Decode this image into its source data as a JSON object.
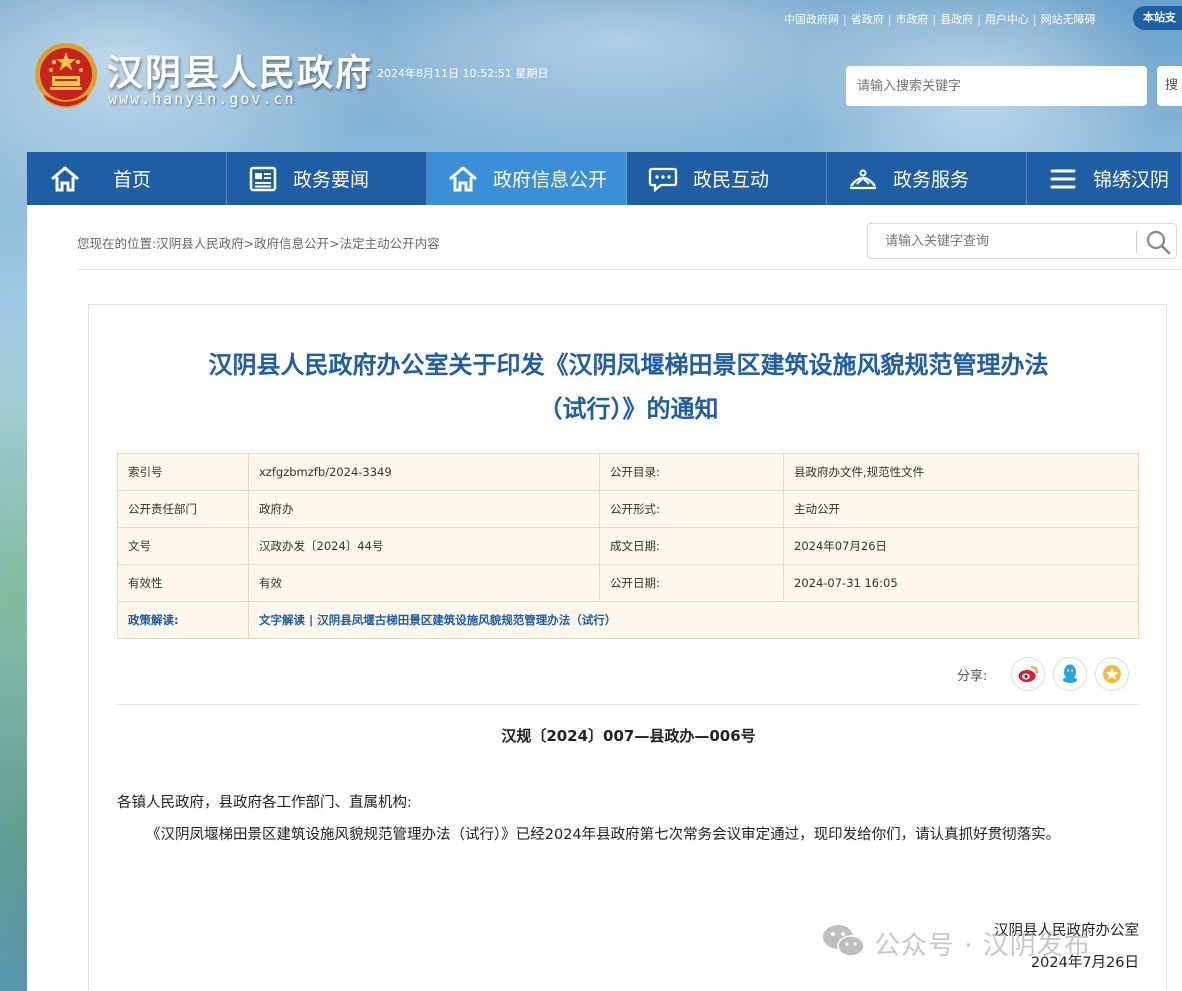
{
  "header": {
    "top_links": [
      "中国政府网",
      "省政府",
      "市政府",
      "县政府",
      "用户中心",
      "网站无障碍"
    ],
    "support_label": "本站支",
    "site_title": "汉阴县人民政府",
    "site_domain": "www.hanyin.gov.cn",
    "datetime": "2024年8月11日 10:52:51 星期日",
    "search_placeholder": "请输入搜索关键字",
    "search_button": "搜"
  },
  "nav": {
    "items": [
      {
        "label": "首页",
        "icon": "home-icon"
      },
      {
        "label": "政务要闻",
        "icon": "news-icon"
      },
      {
        "label": "政府信息公开",
        "icon": "home-icon"
      },
      {
        "label": "政民互动",
        "icon": "chat-icon"
      },
      {
        "label": "政务服务",
        "icon": "service-icon"
      },
      {
        "label": "锦绣汉阴",
        "icon": "menu-icon"
      }
    ],
    "active_index": 2
  },
  "breadcrumb": "您现在的位置:汉阴县人民政府>政府信息公开>法定主动公开内容",
  "inner_search": {
    "placeholder": "请输入关键字查询"
  },
  "article": {
    "title_line1": "汉阴县人民政府办公室关于印发《汉阴凤堰梯田景区建筑设施风貌规范管理办法",
    "title_line2": "（试行）》的通知",
    "meta": {
      "index_label": "索引号",
      "index_value": "xzfgzbmzfb/2024-3349",
      "catalog_label": "公开目录:",
      "catalog_value": "县政府办文件,规范性文件",
      "dept_label": "公开责任部门",
      "dept_value": "政府办",
      "form_label": "公开形式:",
      "form_value": "主动公开",
      "docnum_label": "文号",
      "docnum_value": "汉政办发〔2024〕44号",
      "created_label": "成文日期:",
      "created_value": "2024年07月26日",
      "validity_label": "有效性",
      "validity_value": "有效",
      "published_label": "公开日期:",
      "published_value": "2024-07-31 16:05",
      "policy_label": "政策解读:",
      "policy_value": "文字解读 | 汉阴县凤堰古梯田景区建筑设施风貌规范管理办法（试行）"
    },
    "share_label": "分享:",
    "share_icons": [
      "weibo-icon",
      "qq-icon",
      "favorite-icon"
    ],
    "doc_number": "汉规〔2024〕007—县政办—006号",
    "salutation": "各镇人民政府，县政府各工作部门、直属机构:",
    "body": "《汉阴凤堰梯田景区建筑设施风貌规范管理办法（试行）》已经2024年县政府第七次常务会议审定通过，现印发给你们，请认真抓好贯彻落实。",
    "sign_org": "汉阴县人民政府办公室",
    "sign_date": "2024年7月26日"
  },
  "watermark": "公众号 · 汉阴发布",
  "colors": {
    "nav_bg": "#1f5da5",
    "nav_active": "#3b8fd6",
    "title_blue": "#1f5da5",
    "meta_bg": "#fdf7ec"
  }
}
